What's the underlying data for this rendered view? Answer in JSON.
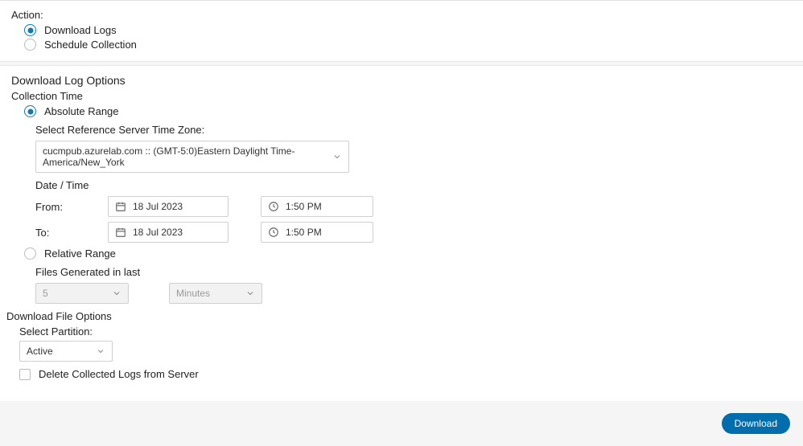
{
  "action": {
    "label": "Action:",
    "options": {
      "download": "Download Logs",
      "schedule": "Schedule Collection"
    }
  },
  "dlog": {
    "title": "Download Log Options",
    "collTime": "Collection Time",
    "abs": "Absolute Range",
    "rel": "Relative Range",
    "tzLabel": "Select Reference Server Time Zone:",
    "tzValue": "cucmpub.azurelab.com :: (GMT-5:0)Eastern Daylight Time-America/New_York",
    "dateTime": "Date / Time",
    "from": "From:",
    "to": "To:",
    "fromDate": "18 Jul 2023",
    "fromTime": "1:50 PM",
    "toDate": "18 Jul 2023",
    "toTime": "1:50 PM",
    "filesGen": "Files Generated in last",
    "filesNum": "5",
    "filesUnit": "Minutes"
  },
  "dfile": {
    "title": "Download File Options",
    "partLabel": "Select Partition:",
    "partValue": "Active",
    "delLabel": "Delete Collected Logs from Server"
  },
  "footer": {
    "download": "Download"
  }
}
